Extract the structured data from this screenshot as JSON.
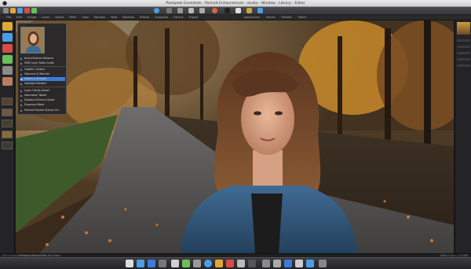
{
  "window": {
    "title": "Pixelpeek Essentials - Portrait Enhancement - studio - Window - Library - Editor"
  },
  "menus": [
    "File",
    "Edit",
    "Image",
    "Layer",
    "Select",
    "Filter",
    "View",
    "Window",
    "Help",
    "Develop",
    "Effects",
    "Snapshot",
    "Library",
    "Export"
  ],
  "right_menus": [
    "Adjustment",
    "Panels",
    "Presets",
    "Share"
  ],
  "popup": {
    "items": [
      "Auto-Enhance Balance",
      "HDR Layer Ratio Guide",
      "Lighten Contour",
      "Vibrance & Warmth",
      "Soften & Smooth",
      "Highlight Restore",
      "Layer Clarity Detail",
      "Saturation Tweak",
      "Shadow Enhance Boost",
      "Exposure Mode",
      "Portrait Presets Stamp  Ctrl"
    ]
  },
  "status": {
    "left": "Pixelpeek Portrait    File   Tool   Editor",
    "zoom": "1800 x 10    x - 1.5 000",
    "left_small": "100%   Snapshot Edit   ·   Editor   Stamp"
  },
  "colors": {
    "accent": "#3d7bd8",
    "toolbar_dark": "#38383c"
  }
}
